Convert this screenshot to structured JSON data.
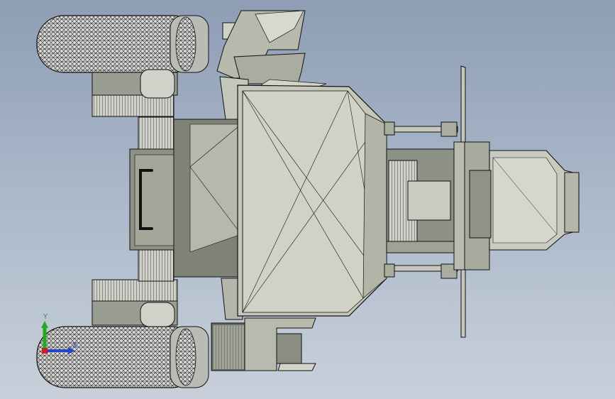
{
  "viewport": {
    "background_top": "#8d9db4",
    "background_bottom": "#c9d0db"
  },
  "model": {
    "body_fill": "#c5c7ba",
    "body_dark": "#8f9285",
    "body_shadow": "#6f7267",
    "tire_fill": "#d9dbd7",
    "edge_color": "#1a1a1a"
  },
  "triad": {
    "y_label": "Y",
    "x_label": "X",
    "y_color": "#22aa22",
    "x_color": "#2345c8",
    "origin_color": "#cc2222"
  }
}
